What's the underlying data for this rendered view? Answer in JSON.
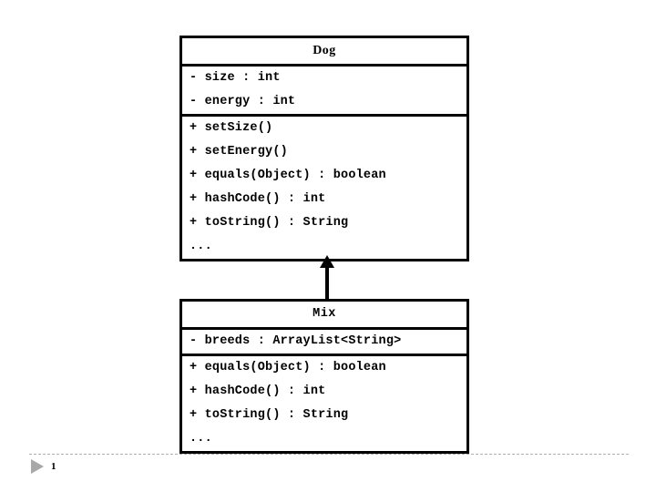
{
  "slide": {
    "background_color": "#ffffff",
    "line_color": "#000000",
    "footer": {
      "page_number": "1",
      "marker_icon": "play-triangle-icon",
      "rule_color": "#b0b0b0",
      "marker_color": "#a8a8a8"
    }
  },
  "diagram": {
    "type": "uml-class-diagram",
    "relationship": {
      "kind": "generalization",
      "label": "",
      "from": "Mix",
      "to": "Dog",
      "arrow_icon": "inheritance-arrow-icon"
    },
    "classes": [
      {
        "id": "dog",
        "name": "Dog",
        "attributes": [
          "- size : int",
          "- energy : int"
        ],
        "operations": [
          "+ setSize()",
          "+ setEnergy()",
          "+ equals(Object) : boolean",
          "+ hashCode() : int",
          "+ toString() : String",
          "..."
        ]
      },
      {
        "id": "mix",
        "name": "Mix",
        "attributes": [
          "- breeds : ArrayList<String>"
        ],
        "operations": [
          "+ equals(Object) : boolean",
          "+ hashCode() : int",
          "+ toString() : String",
          "..."
        ]
      }
    ]
  }
}
